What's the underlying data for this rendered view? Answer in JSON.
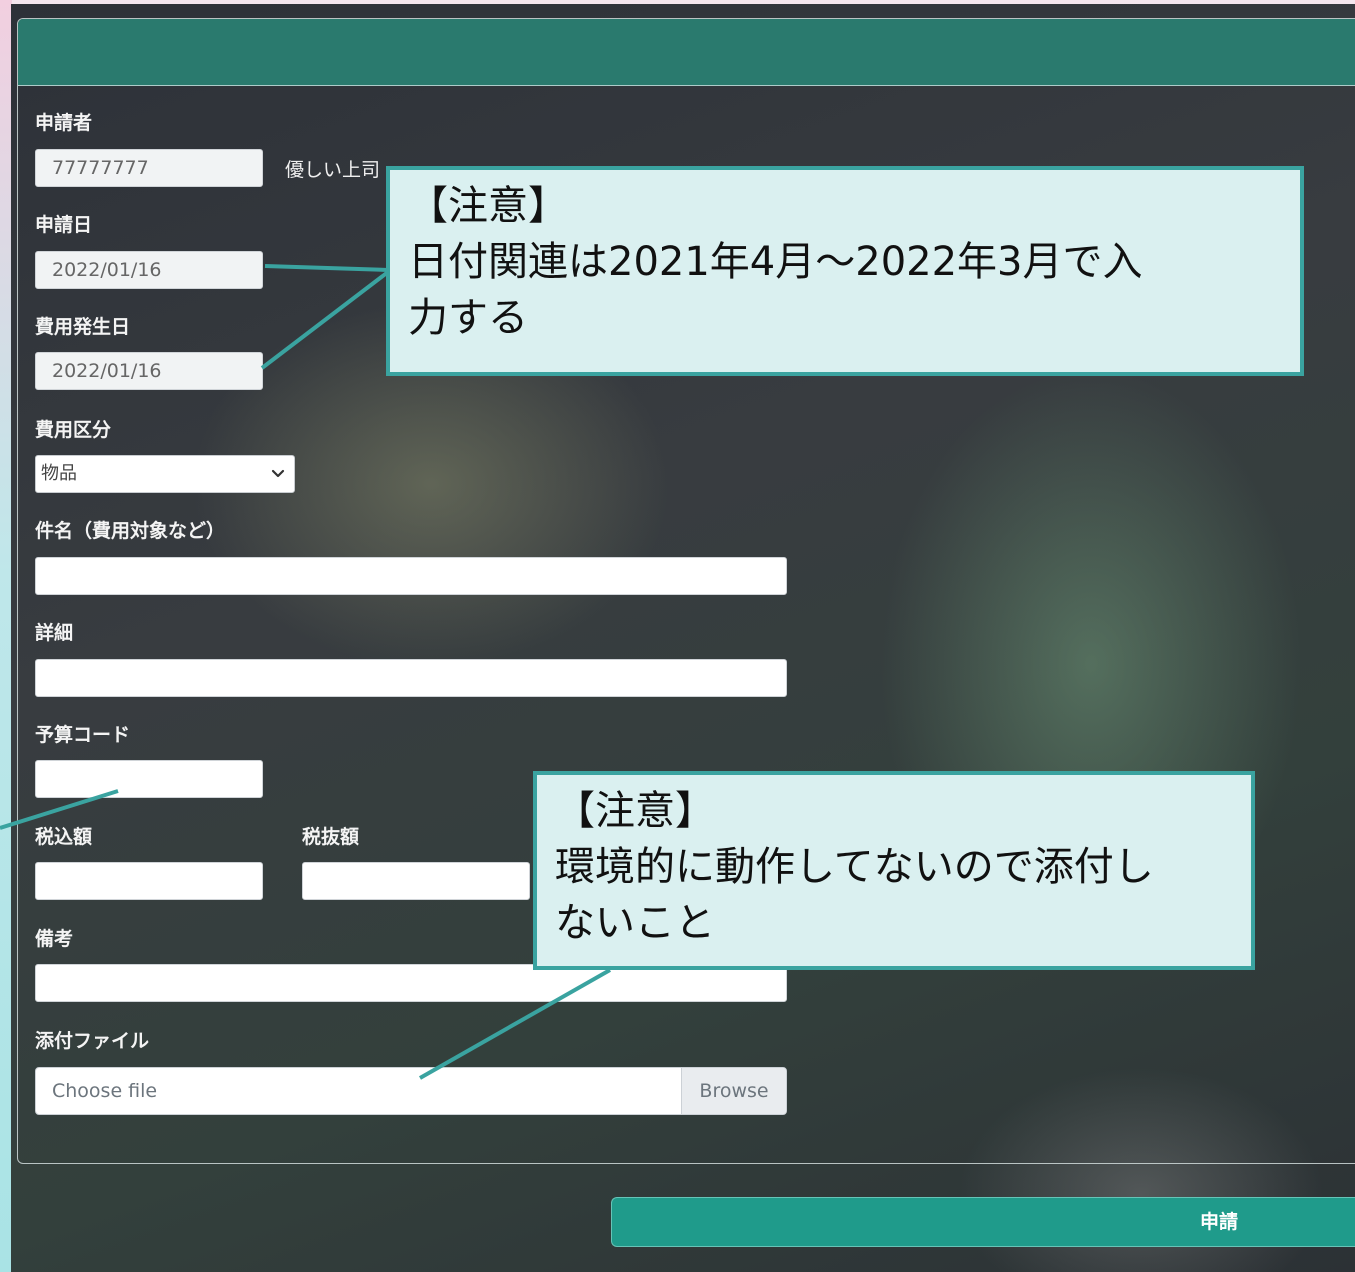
{
  "form": {
    "applicant_label": "申請者",
    "applicant_id": "77777777",
    "applicant_name": "優しい上司",
    "application_date_label": "申請日",
    "application_date": "2022/01/16",
    "expense_date_label": "費用発生日",
    "expense_date": "2022/01/16",
    "expense_category_label": "費用区分",
    "expense_category_selected": "物品",
    "subject_label": "件名（費用対象など）",
    "subject_value": "",
    "details_label": "詳細",
    "details_value": "",
    "budget_code_label": "予算コード",
    "budget_code_value": "",
    "tax_included_label": "税込額",
    "tax_included_value": "",
    "tax_excluded_label": "税抜額",
    "tax_excluded_value": "",
    "remarks_label": "備考",
    "remarks_value": "",
    "attachment_label": "添付ファイル",
    "attachment_placeholder": "Choose file",
    "attachment_browse": "Browse",
    "submit_label": "申請"
  },
  "annotations": {
    "date_note": {
      "title": "【注意】",
      "line1": "日付関連は2021年4月～2022年3月で入",
      "line2": "力する"
    },
    "attachment_note": {
      "title": "【注意】",
      "line1": "環境的に動作してないので添付し",
      "line2": "ないこと"
    }
  },
  "colors": {
    "header_teal": "#2a7a6e",
    "submit_teal": "#1f9b8b",
    "callout_border": "#3aa3a0",
    "callout_fill": "#daf0f0"
  },
  "icons": {
    "select_arrow": "chevron-down-icon"
  }
}
